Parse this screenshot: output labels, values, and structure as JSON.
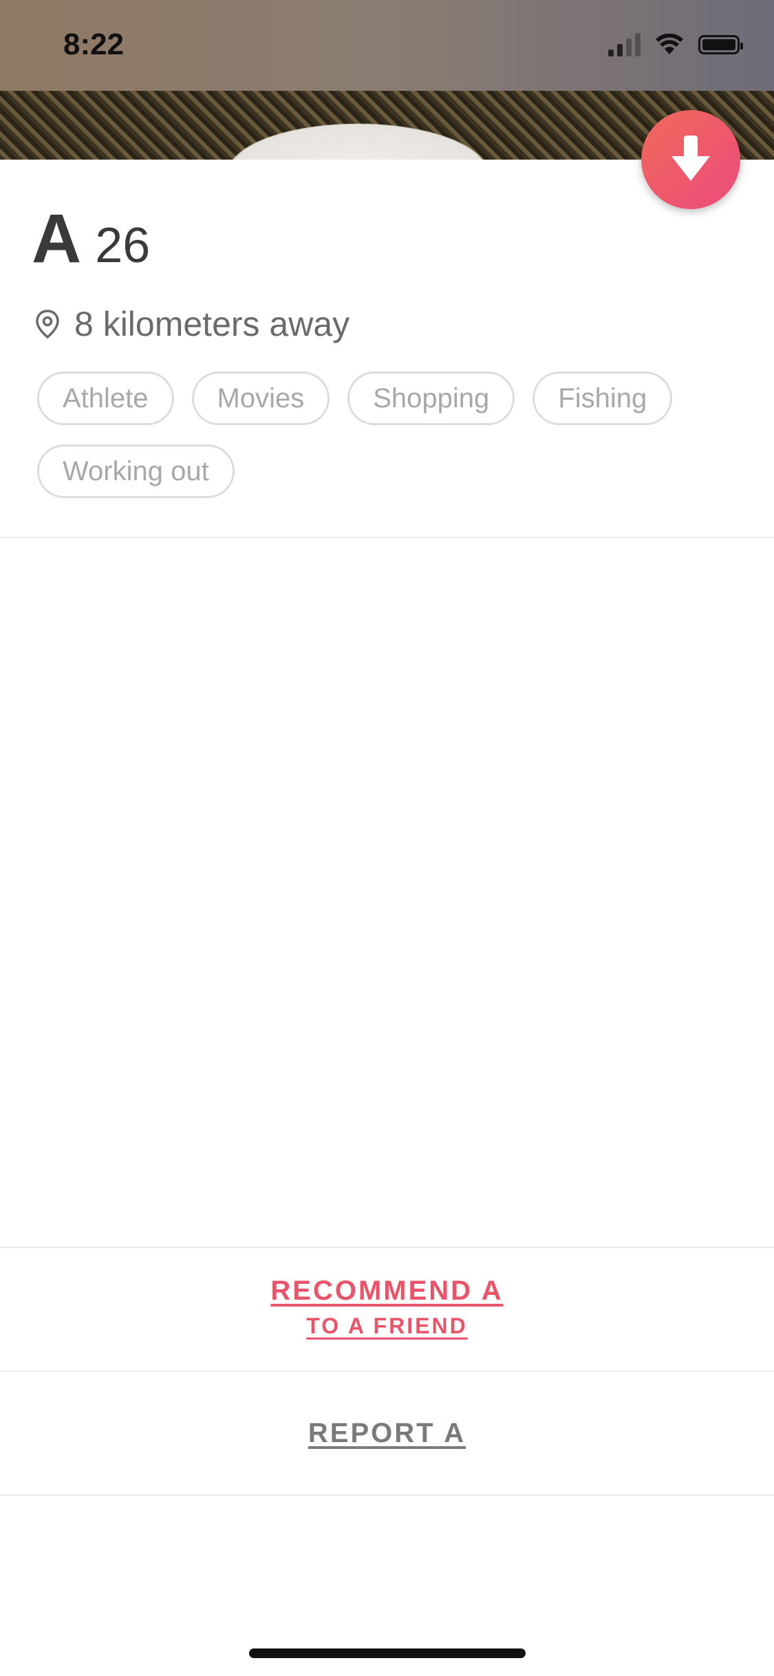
{
  "status_bar": {
    "time": "8:22"
  },
  "profile": {
    "name": "A",
    "age": "26",
    "distance": "8 kilometers away",
    "tags": [
      "Athlete",
      "Movies",
      "Shopping",
      "Fishing",
      "Working out"
    ]
  },
  "actions": {
    "recommend_main": "RECOMMEND A",
    "recommend_sub": "TO A FRIEND",
    "report": "REPORT A"
  },
  "colors": {
    "accent": "#e8546a",
    "text_dark": "#3a3a3a",
    "text_muted": "#6a6a6a"
  }
}
